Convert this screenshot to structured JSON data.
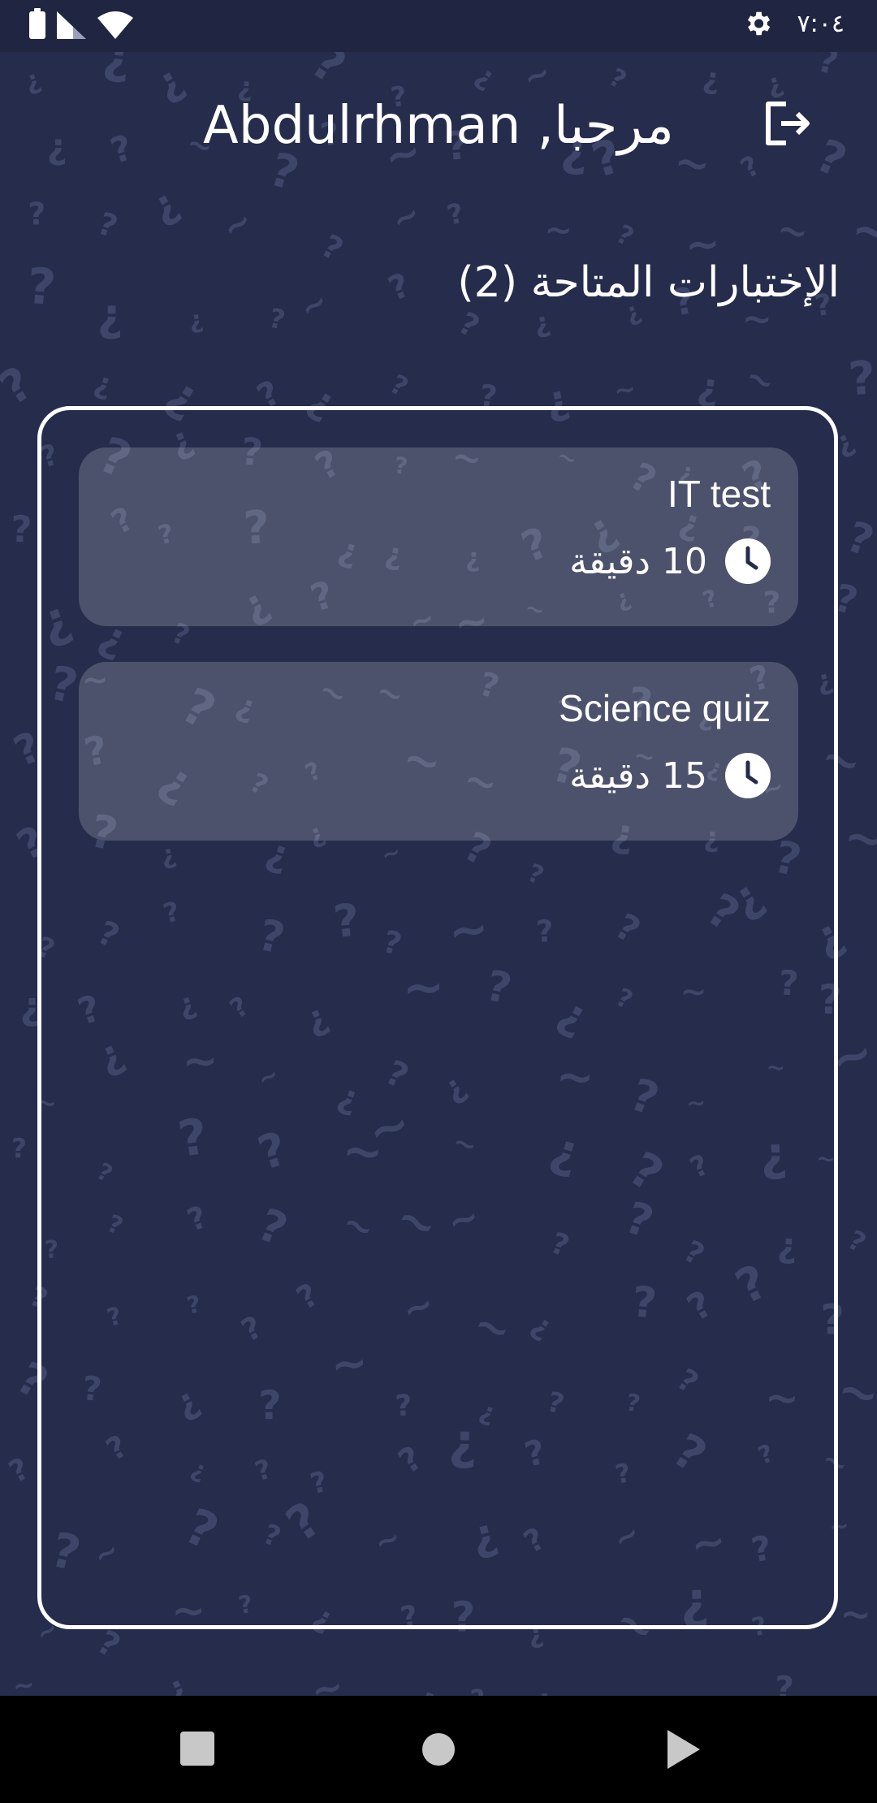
{
  "status_bar": {
    "time": "٧:٠٤",
    "icons": [
      "battery-icon",
      "signal-icon",
      "wifi-icon",
      "settings-icon"
    ]
  },
  "header": {
    "greeting": "مرحبا, Abdulrhman",
    "logout_icon": "logout-icon"
  },
  "section": {
    "title": "الإختبارات المتاحة (2)"
  },
  "quizzes": [
    {
      "title": "IT test",
      "duration": "10 دقيقة"
    },
    {
      "title": "Science quiz",
      "duration": "15 دقيقة"
    }
  ],
  "nav_bar": {
    "buttons": [
      "recents-square-icon",
      "home-circle-icon",
      "back-triangle-icon"
    ]
  },
  "colors": {
    "background": "#262c4c",
    "status_bar": "#202642",
    "card": "rgba(255,255,255,0.18)",
    "border": "#ffffff",
    "pattern": "#3d4668"
  }
}
